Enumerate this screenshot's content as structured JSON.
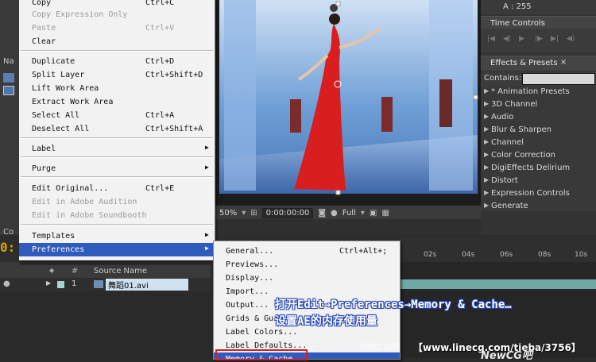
{
  "left_panel": {
    "tab_na": "Na",
    "tab_co": "Co"
  },
  "edit_menu": {
    "items": [
      {
        "label": "Copy",
        "shortcut": "Ctrl+C",
        "disabled": false
      },
      {
        "label": "Copy Expression Only",
        "shortcut": "",
        "disabled": true
      },
      {
        "label": "Paste",
        "shortcut": "Ctrl+V",
        "disabled": true
      },
      {
        "label": "Clear",
        "shortcut": "",
        "disabled": false
      },
      {
        "label": "Duplicate",
        "shortcut": "Ctrl+D",
        "disabled": false
      },
      {
        "label": "Split Layer",
        "shortcut": "Ctrl+Shift+D",
        "disabled": false
      },
      {
        "label": "Lift Work Area",
        "shortcut": "",
        "disabled": false
      },
      {
        "label": "Extract Work Area",
        "shortcut": "",
        "disabled": false
      },
      {
        "label": "Select All",
        "shortcut": "Ctrl+A",
        "disabled": false
      },
      {
        "label": "Deselect All",
        "shortcut": "Ctrl+Shift+A",
        "disabled": false
      },
      {
        "label": "Label",
        "shortcut": "",
        "disabled": false
      },
      {
        "label": "Purge",
        "shortcut": "",
        "disabled": false
      },
      {
        "label": "Edit Original...",
        "shortcut": "Ctrl+E",
        "disabled": false
      },
      {
        "label": "Edit in Adobe Audition",
        "shortcut": "",
        "disabled": true
      },
      {
        "label": "Edit in Adobe Soundbooth",
        "shortcut": "",
        "disabled": true
      },
      {
        "label": "Templates",
        "shortcut": "",
        "disabled": false
      },
      {
        "label": "Preferences",
        "shortcut": "",
        "disabled": false
      }
    ]
  },
  "preferences_menu": {
    "items": [
      {
        "label": "General...",
        "shortcut": "Ctrl+Alt+;"
      },
      {
        "label": "Previews...",
        "shortcut": ""
      },
      {
        "label": "Display...",
        "shortcut": ""
      },
      {
        "label": "Import...",
        "shortcut": ""
      },
      {
        "label": "Output...",
        "shortcut": ""
      },
      {
        "label": "Grids & Gui",
        "shortcut": ""
      },
      {
        "label": "Label Colors...",
        "shortcut": ""
      },
      {
        "label": "Label Defaults...",
        "shortcut": ""
      },
      {
        "label": "Memory & Cache...",
        "shortcut": ""
      }
    ]
  },
  "viewer_toolbar": {
    "zoom": "50%",
    "timecode": "0:00:00:00",
    "resolution": "Full"
  },
  "info_panel": {
    "alpha": "A : 255"
  },
  "time_controls": {
    "title": "Time Controls"
  },
  "effects_presets": {
    "title": "Effects & Presets",
    "contains_label": "Contains:",
    "search_value": "",
    "items": [
      "* Animation Presets",
      "3D Channel",
      "Audio",
      "Blur & Sharpen",
      "Channel",
      "Color Correction",
      "DigiEffects Delirium",
      "Distort",
      "Expression Controls",
      "Generate"
    ]
  },
  "timeline": {
    "current_time_partial": "0:",
    "col_source_name": "Source Name",
    "layer_number": "1",
    "layer_name": "舞蹈01.avi",
    "ruler_ticks": [
      "02s",
      "04s",
      "06s",
      "08s",
      "10s"
    ]
  },
  "annotations": {
    "line1": "打开Edit→Preferences→Memory & Cache…",
    "line2": "设置AE的内存使用量",
    "url": "【www.linecg.com/tieba/3756】",
    "watermark1": "特效CG吧",
    "watermark2": "NewCG吧"
  },
  "colors": {
    "menu_highlight": "#2f5bbf",
    "annotation_outline": "#2242b5",
    "timecode": "#d6a300",
    "layer_bar": "#6fa9a6",
    "red_callout": "#d42020"
  }
}
